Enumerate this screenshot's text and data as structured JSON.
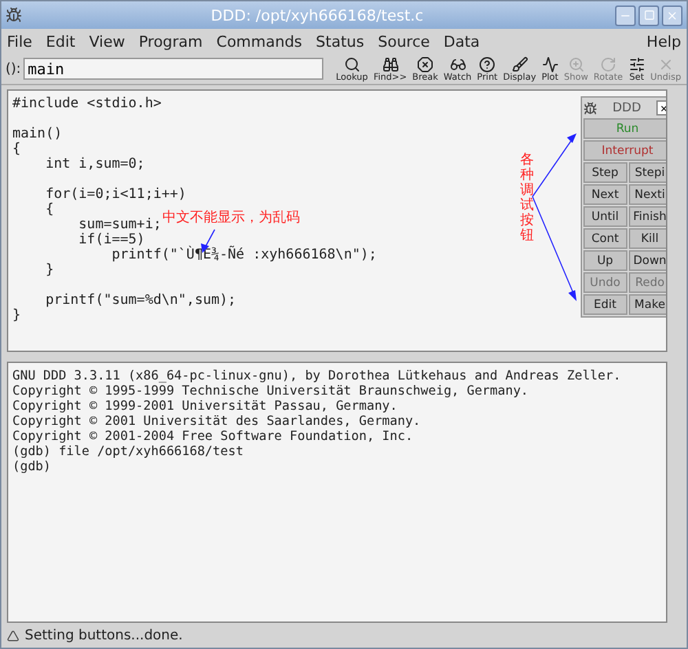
{
  "window": {
    "title": "DDD: /opt/xyh666168/test.c"
  },
  "menu": {
    "items": [
      "File",
      "Edit",
      "View",
      "Program",
      "Commands",
      "Status",
      "Source",
      "Data"
    ],
    "help": "Help"
  },
  "toolbar": {
    "arg_label": "():",
    "arg_value": "main",
    "buttons": [
      {
        "label": "Lookup",
        "kind": "lookup",
        "disabled": false
      },
      {
        "label": "Find>>",
        "kind": "find",
        "disabled": false
      },
      {
        "label": "Break",
        "kind": "break",
        "disabled": false
      },
      {
        "label": "Watch",
        "kind": "watch",
        "disabled": false
      },
      {
        "label": "Print",
        "kind": "print",
        "disabled": false
      },
      {
        "label": "Display",
        "kind": "display",
        "disabled": false
      },
      {
        "label": "Plot",
        "kind": "plot",
        "disabled": false
      },
      {
        "label": "Show",
        "kind": "show",
        "disabled": true
      },
      {
        "label": "Rotate",
        "kind": "rotate",
        "disabled": true
      },
      {
        "label": "Set",
        "kind": "set",
        "disabled": false
      },
      {
        "label": "Undisp",
        "kind": "undisp",
        "disabled": true
      }
    ]
  },
  "source": {
    "blocks": [
      [
        "#include <stdio.h>"
      ],
      [
        "main()",
        "{",
        "    int i,sum=0;"
      ],
      [
        "    for(i=0;i<11;i++)",
        "    {",
        "        sum=sum+i;",
        "        if(i==5)",
        "            printf(\"`Ù¶È¾-Ñé :xyh666168\\n\");",
        "    }"
      ],
      [
        "    printf(\"sum=%d\\n\",sum);",
        "}"
      ]
    ]
  },
  "annotations": [
    {
      "kind": "horizontal",
      "text": "中文不能显示，为乱码"
    },
    {
      "kind": "vertical",
      "text": "各种调试按钮"
    }
  ],
  "command_tool": {
    "title": "DDD",
    "close": "×",
    "buttons": [
      {
        "label": "Run",
        "kind": "run",
        "disabled": false
      },
      {
        "label": "Interrupt",
        "kind": "interrupt",
        "disabled": false
      },
      {
        "label": "Step",
        "kind": "normal",
        "disabled": false
      },
      {
        "label": "Stepi",
        "kind": "normal",
        "disabled": false
      },
      {
        "label": "Next",
        "kind": "normal",
        "disabled": false
      },
      {
        "label": "Nexti",
        "kind": "normal",
        "disabled": false
      },
      {
        "label": "Until",
        "kind": "normal",
        "disabled": false
      },
      {
        "label": "Finish",
        "kind": "normal",
        "disabled": false
      },
      {
        "label": "Cont",
        "kind": "normal",
        "disabled": false
      },
      {
        "label": "Kill",
        "kind": "normal",
        "disabled": false
      },
      {
        "label": "Up",
        "kind": "normal",
        "disabled": false
      },
      {
        "label": "Down",
        "kind": "normal",
        "disabled": false
      },
      {
        "label": "Undo",
        "kind": "normal",
        "disabled": true
      },
      {
        "label": "Redo",
        "kind": "normal",
        "disabled": true
      },
      {
        "label": "Edit",
        "kind": "normal",
        "disabled": false
      },
      {
        "label": "Make",
        "kind": "normal",
        "disabled": false
      }
    ]
  },
  "console": {
    "lines": [
      "GNU DDD 3.3.11 (x86_64-pc-linux-gnu), by Dorothea Lütkehaus and Andreas Zeller.",
      "Copyright © 1995-1999 Technische Universität Braunschweig, Germany.",
      "Copyright © 1999-2001 Universität Passau, Germany.",
      "Copyright © 2001 Universität des Saarlandes, Germany.",
      "Copyright © 2001-2004 Free Software Foundation, Inc.",
      "(gdb) file /opt/xyh666168/test",
      "(gdb)"
    ]
  },
  "status_bar": {
    "text": "Setting buttons...done."
  }
}
